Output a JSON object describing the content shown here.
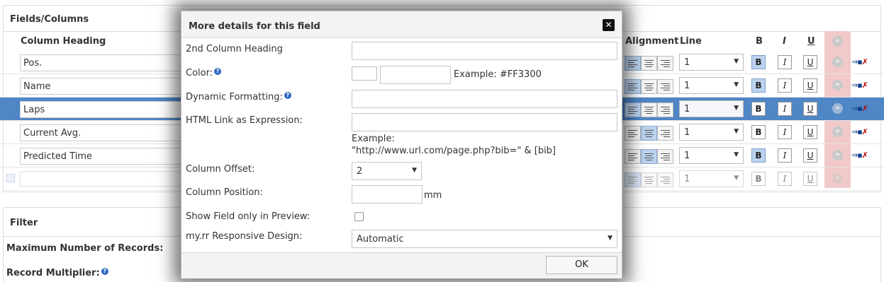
{
  "fields_panel": {
    "title": "Fields/Columns",
    "headers": {
      "column_heading": "Column Heading",
      "alignment": "Alignment",
      "line": "Line",
      "bold": "B",
      "italic": "I",
      "underline": "U"
    },
    "rows": [
      {
        "heading": "Pos.",
        "line": "1",
        "align": "left",
        "bold": true,
        "selected": false
      },
      {
        "heading": "Name",
        "line": "1",
        "align": "left",
        "bold": true,
        "selected": false
      },
      {
        "heading": "Laps",
        "line": "1",
        "align": "left",
        "bold": false,
        "selected": true
      },
      {
        "heading": "Current Avg.",
        "line": "1",
        "align": "center",
        "bold": false,
        "selected": false
      },
      {
        "heading": "Predicted Time",
        "line": "1",
        "align": "center",
        "bold": true,
        "selected": false
      },
      {
        "heading": "",
        "line": "1",
        "align": "left",
        "bold": false,
        "selected": false
      }
    ],
    "bold_label": "B",
    "italic_label": "I",
    "underline_label": "U",
    "circle_glyph": "»",
    "colors": {
      "selected_row": "#4f86c6",
      "red_column": "#f2c9c9",
      "active_toggle": "#bcd3ef"
    }
  },
  "filter_panel": {
    "title": "Filter",
    "max_records_label": "Maximum Number of Records:",
    "record_multiplier_label": "Record Multiplier:"
  },
  "modal": {
    "title": "More details for this field",
    "close_glyph": "✕",
    "second_heading_label": "2nd Column Heading",
    "second_heading_value": "",
    "color_label": "Color:",
    "color_value": "",
    "color_example": "Example: #FF3300",
    "dynamic_formatting_label": "Dynamic Formatting:",
    "dynamic_formatting_value": "",
    "html_link_label": "HTML Link as Expression:",
    "html_link_value": "",
    "html_link_example_1": "Example:",
    "html_link_example_2": "\"http://www.url.com/page.php?bib=\" & [bib]",
    "column_offset_label": "Column Offset:",
    "column_offset_value": "2",
    "column_position_label": "Column Position:",
    "column_position_value": "",
    "column_position_unit": "mm",
    "show_preview_label": "Show Field only in Preview:",
    "show_preview_checked": false,
    "responsive_label": "my.rr Responsive Design:",
    "responsive_value": "Automatic",
    "ok_label": "OK",
    "help_glyph": "?"
  }
}
